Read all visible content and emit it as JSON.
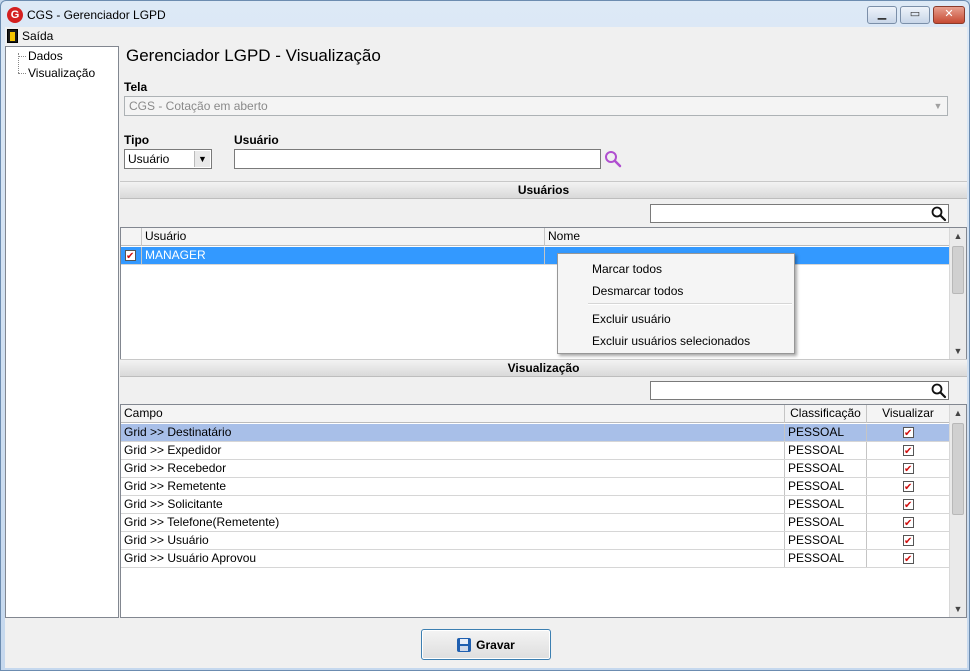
{
  "window": {
    "title": "CGS - Gerenciador LGPD",
    "app_icon_letter": "G",
    "min_glyph": "▁",
    "max_glyph": "▭",
    "close_glyph": "✕"
  },
  "menu": {
    "exit_label": "Saída"
  },
  "tree": {
    "items": [
      "Dados",
      "Visualização"
    ]
  },
  "page_title": "Gerenciador LGPD - Visualização",
  "form": {
    "tela_label": "Tela",
    "tela_value": "CGS - Cotação em aberto",
    "tipo_label": "Tipo",
    "tipo_value": "Usuário",
    "usuario_label": "Usuário",
    "usuario_value": ""
  },
  "users_section": {
    "title": "Usuários",
    "search_value": "",
    "columns": [
      "Usuário",
      "Nome"
    ],
    "rows": [
      {
        "checked": true,
        "usuario": "MANAGER",
        "nome": ""
      }
    ]
  },
  "context_menu": {
    "items": [
      "Marcar todos",
      "Desmarcar todos",
      "Excluir usuário",
      "Excluir usuários selecionados"
    ]
  },
  "view_section": {
    "title": "Visualização",
    "search_value": "",
    "columns": [
      "Campo",
      "Classificação",
      "Visualizar"
    ],
    "rows": [
      {
        "campo": "Grid >> Destinatário",
        "classificacao": "PESSOAL",
        "visualizar": true
      },
      {
        "campo": "Grid >> Expedidor",
        "classificacao": "PESSOAL",
        "visualizar": true
      },
      {
        "campo": "Grid >> Recebedor",
        "classificacao": "PESSOAL",
        "visualizar": true
      },
      {
        "campo": "Grid >> Remetente",
        "classificacao": "PESSOAL",
        "visualizar": true
      },
      {
        "campo": "Grid >> Solicitante",
        "classificacao": "PESSOAL",
        "visualizar": true
      },
      {
        "campo": "Grid >> Telefone(Remetente)",
        "classificacao": "PESSOAL",
        "visualizar": true
      },
      {
        "campo": "Grid >> Usuário",
        "classificacao": "PESSOAL",
        "visualizar": true
      },
      {
        "campo": "Grid >> Usuário Aprovou",
        "classificacao": "PESSOAL",
        "visualizar": true
      }
    ]
  },
  "save_button": {
    "label": "Gravar"
  },
  "colors": {
    "selected_row": "#3399ff",
    "highlight_row": "#a8bfe8",
    "check": "#d01010",
    "search_icon_purple": "#b04fd0"
  }
}
